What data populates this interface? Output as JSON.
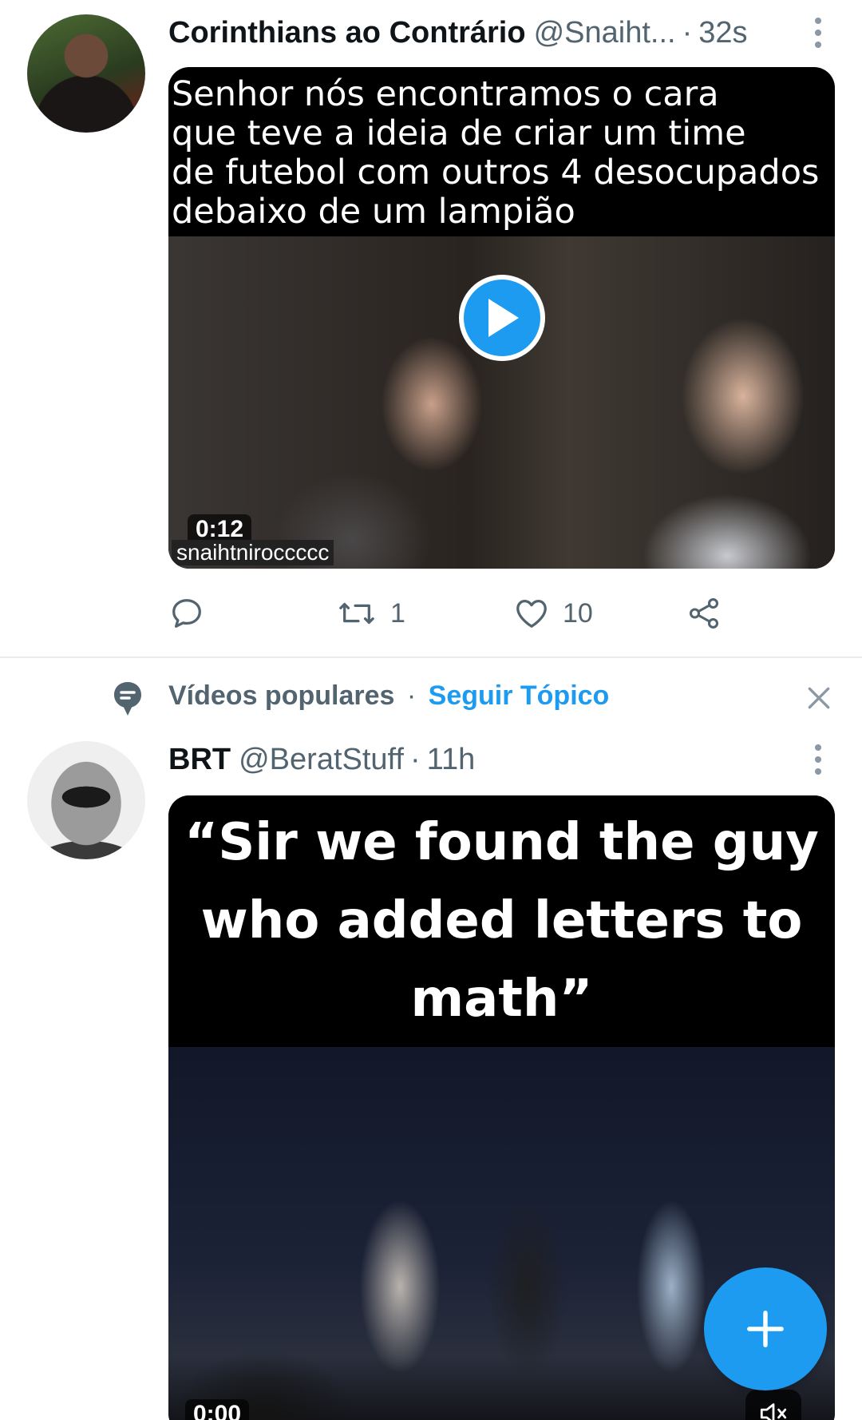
{
  "tweet1": {
    "name": "Corinthians ao Contrário",
    "handle": "@Snaiht...",
    "separator": "·",
    "time": "32s",
    "caption": "Senhor nós encontramos o cara\nque teve a ideia de criar um time\nde futebol com outros 4 desocupados\ndebaixo de um lampião",
    "duration": "0:12",
    "watermark": "snaihtniroccccc",
    "retweets": "1",
    "likes": "10"
  },
  "topic": {
    "label": "Vídeos populares",
    "separator": "·",
    "follow_label": "Seguir Tópico"
  },
  "tweet2": {
    "name": "BRT",
    "handle": "@BeratStuff",
    "separator": "·",
    "time": "11h",
    "caption": "“Sir we found the guy who added letters to math”",
    "duration": "0:00"
  },
  "colors": {
    "accent": "#1d9bf0",
    "secondary_text": "#536471"
  }
}
